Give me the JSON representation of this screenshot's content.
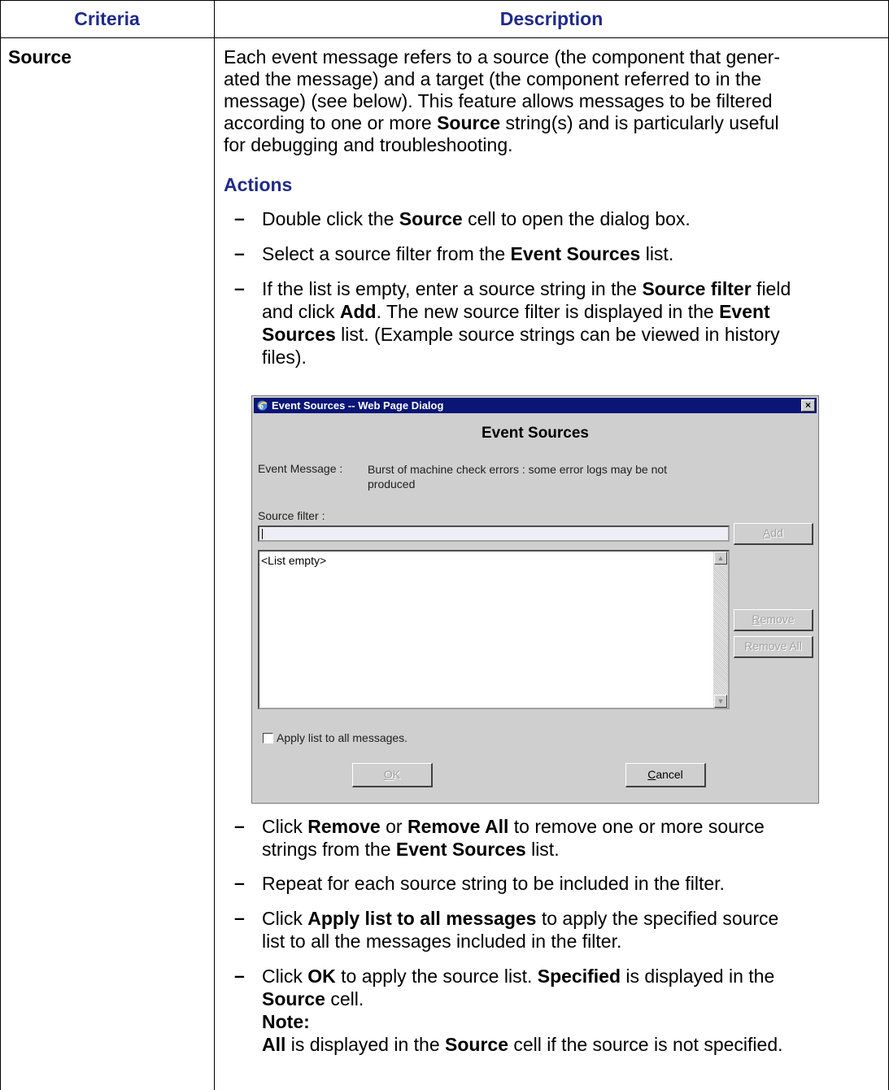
{
  "table": {
    "headers": [
      "Criteria",
      "Description"
    ],
    "criteria": "Source",
    "intro_lines": [
      "Each event message refers to a source (the component that gener-",
      "ated the message) and a target (the component referred to in the",
      "message) (see below). This feature allows messages to be filtered",
      "according to one or more ",
      "Source",
      " string(s) and is particularly useful",
      "for debugging and troubleshooting."
    ],
    "actions_title": "Actions",
    "bullet_char": "–",
    "bullets": {
      "b1": [
        "Double click the ",
        "Source",
        " cell to open the dialog box."
      ],
      "b2": [
        "Select a source filter from the ",
        "Event Sources",
        " list."
      ],
      "b3": [
        "If the list is empty, enter a source string in the ",
        "Source filter",
        " field",
        "and click ",
        "Add",
        ". The new source filter is displayed in the ",
        "Event",
        "Sources",
        " list. (Example source strings can be viewed in history",
        "files)."
      ],
      "b4": [
        "Click ",
        "Remove",
        " or ",
        "Remove All",
        " to remove one or more source",
        "strings from the ",
        "Event Sources",
        " list."
      ],
      "b5": [
        "Repeat for each source string to be included in the filter."
      ],
      "b6": [
        "Click ",
        "Apply list to all messages",
        " to apply the specified source",
        "list to all the messages included in the filter."
      ],
      "b7": [
        "Click ",
        "OK",
        " to apply the source list. ",
        "Specified",
        " is displayed in the",
        "Source",
        " cell.",
        "Note:",
        "All",
        " is displayed in the ",
        "Source",
        " cell if the source is not specified."
      ]
    }
  },
  "dialog": {
    "window_title": "Event Sources -- Web Page Dialog",
    "close_glyph": "×",
    "heading": "Event Sources",
    "event_message_label": "Event Message :",
    "event_message_lines": [
      "Burst of machine check errors : some error logs may be not",
      "produced"
    ],
    "source_filter_label": "Source filter :",
    "source_filter_value": "",
    "add_button": {
      "first": "A",
      "rest": "dd"
    },
    "list_empty": "<List empty>",
    "remove_button": {
      "first": "R",
      "rest": "emove"
    },
    "remove_all_button": "Remove All",
    "apply_checkbox_label": "Apply list to all messages.",
    "apply_checked": false,
    "ok_button": {
      "first": "O",
      "rest": "K"
    },
    "cancel_button": {
      "first": "C",
      "rest": "ancel"
    },
    "scroll_up": "▲",
    "scroll_down": "▼"
  },
  "colors": {
    "header_text": "#1f2a8c",
    "title_bar": "#0a1576",
    "dialog_bg": "#cfcfcf"
  }
}
